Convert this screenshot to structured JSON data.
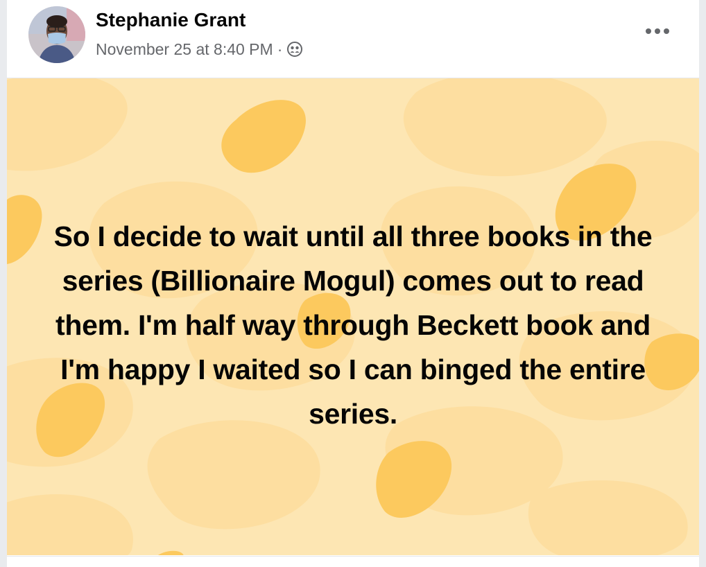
{
  "post": {
    "author": "Stephanie Grant",
    "timestamp": "November 25 at 8:40 PM",
    "separator": "·",
    "audience_icon": "friends-icon",
    "more_icon": "more-options-icon",
    "text": "So I decide to wait until all three books in the series (Billionaire Mogul) comes out to read them. I'm half way through Beckett book and I'm happy I waited so I can binged the entire series.",
    "background_colors": {
      "base": "#fde6b3",
      "light_blob": "#fddea0",
      "dark_blob": "#fcc95e"
    }
  }
}
